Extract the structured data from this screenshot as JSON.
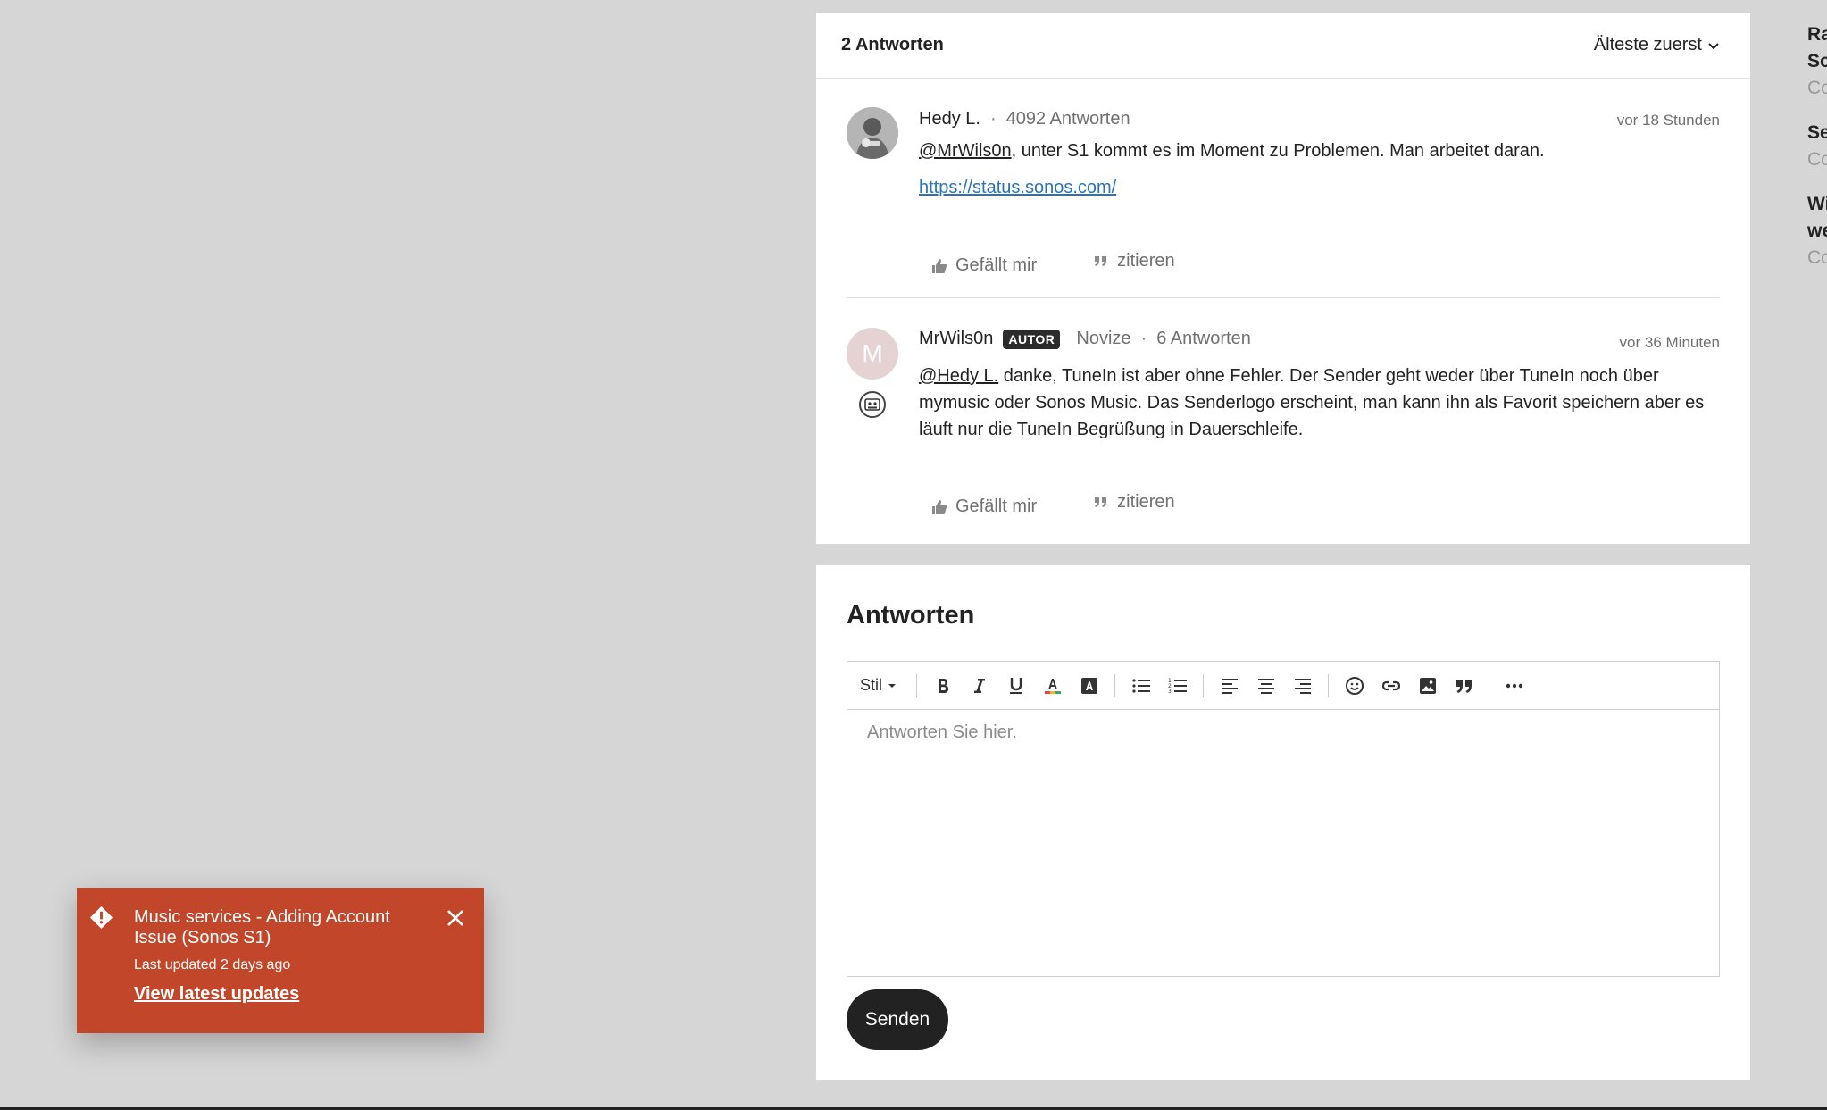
{
  "replies": {
    "count_label": "2 Antworten",
    "sort_label": "Älteste zuerst"
  },
  "posts": [
    {
      "author": "Hedy L.",
      "reply_count": "4092 Antworten",
      "time": "vor 18 Stunden",
      "mention": "@MrWils0n",
      "text": ", unter S1 kommt es im Moment zu Problemen. Man arbeitet daran.",
      "link": "https://status.sonos.com/",
      "like_label": "Gefällt mir",
      "quote_label": "zitieren"
    },
    {
      "author": "MrWils0n",
      "avatar_initial": "M",
      "author_tag": "AUTOR",
      "rank": "Novize",
      "reply_count": "6 Antworten",
      "time": "vor 36 Minuten",
      "mention": "@Hedy L.",
      "text": " danke, TuneIn ist aber ohne Fehler. Der Sender geht weder über TuneIn noch über mymusic oder Sonos Music. Das Senderlogo erscheint, man kann ihn als Favorit speichern aber es läuft nur die TuneIn Begrüßung in Dauerschleife.",
      "like_label": "Gefällt mir",
      "quote_label": "zitieren"
    }
  ],
  "editor": {
    "title": "Antworten",
    "style_label": "Stil",
    "placeholder": "Antworten Sie hier.",
    "send_label": "Senden"
  },
  "right_column": [
    {
      "title": "Ra",
      "title2": "Sc",
      "sub": "Co"
    },
    {
      "title": "Se",
      "sub": "Co"
    },
    {
      "title": "Wi",
      "title2": "we",
      "sub": "Co"
    }
  ],
  "toast": {
    "title": "Music services - Adding Account Issue (Sonos S1)",
    "updated": "Last updated 2 days ago",
    "link_label": "View latest updates"
  },
  "colors": {
    "toast_bg": "#c2472a",
    "link": "#2a73b6",
    "page_bg": "#d6d6d6"
  }
}
